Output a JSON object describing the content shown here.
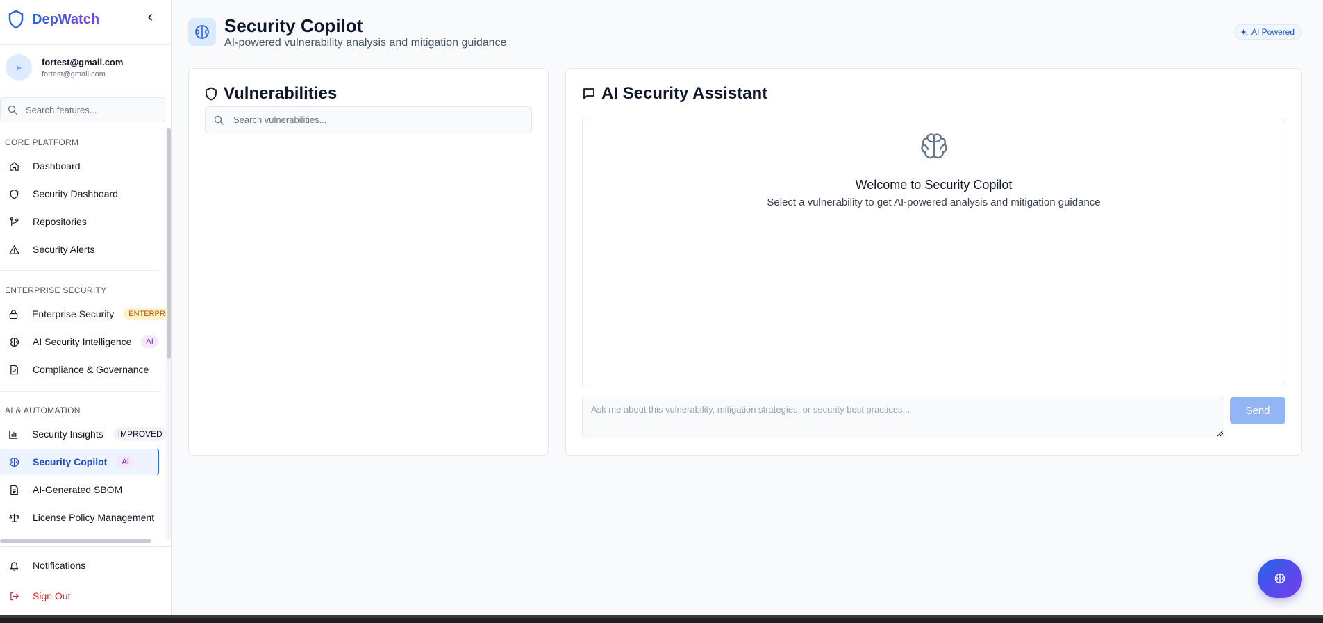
{
  "app": {
    "name": "DepWatch"
  },
  "user": {
    "initial": "F",
    "name": "fortest@gmail.com",
    "email": "fortest@gmail.com"
  },
  "sidebar": {
    "search_placeholder": "Search features...",
    "sections": [
      {
        "title": "CORE PLATFORM",
        "items": [
          {
            "label": "Dashboard",
            "icon": "home-icon"
          },
          {
            "label": "Security Dashboard",
            "icon": "shield-icon"
          },
          {
            "label": "Repositories",
            "icon": "git-branch-icon"
          },
          {
            "label": "Security Alerts",
            "icon": "alert-triangle-icon"
          }
        ]
      },
      {
        "title": "ENTERPRISE SECURITY",
        "items": [
          {
            "label": "Enterprise Security",
            "icon": "lock-icon",
            "badge": "ENTERPRISE"
          },
          {
            "label": "AI Security Intelligence",
            "icon": "brain-icon",
            "badge": "AI"
          },
          {
            "label": "Compliance & Governance",
            "icon": "file-check-icon"
          }
        ]
      },
      {
        "title": "AI & AUTOMATION",
        "items": [
          {
            "label": "Security Insights",
            "icon": "bar-chart-icon",
            "badge": "IMPROVED"
          },
          {
            "label": "Security Copilot",
            "icon": "brain-icon",
            "badge": "AI",
            "active": true
          },
          {
            "label": "AI-Generated SBOM",
            "icon": "file-text-icon"
          },
          {
            "label": "License Policy Management",
            "icon": "scale-icon"
          }
        ]
      }
    ],
    "bottom": [
      {
        "label": "Notifications",
        "icon": "bell-icon"
      },
      {
        "label": "Sign Out",
        "icon": "log-out-icon"
      }
    ]
  },
  "header": {
    "title": "Security Copilot",
    "subtitle": "AI-powered vulnerability analysis and mitigation guidance",
    "pill": "AI Powered"
  },
  "vulnerabilities": {
    "title": "Vulnerabilities",
    "search_placeholder": "Search vulnerabilities..."
  },
  "assistant": {
    "title": "AI Security Assistant",
    "welcome_title": "Welcome to Security Copilot",
    "welcome_sub": "Select a vulnerability to get AI-powered analysis and mitigation guidance",
    "input_placeholder": "Ask me about this vulnerability, mitigation strategies, or security best practices...",
    "send_label": "Send"
  },
  "colors": {
    "accent": "#2563eb",
    "brand_end": "#7c3aed",
    "danger": "#dc2626"
  }
}
